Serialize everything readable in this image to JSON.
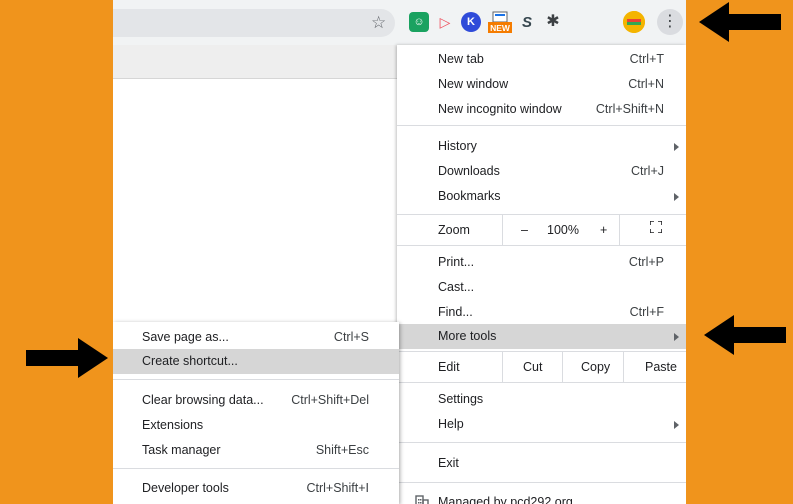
{
  "toolbar": {
    "extensions": [
      {
        "icon": "smiley-extension-icon",
        "glyph": "☺",
        "color": "#1aa260"
      },
      {
        "icon": "play-extension-icon",
        "glyph": "▷",
        "color": "#ee4c5a"
      },
      {
        "icon": "k-extension-icon",
        "glyph": "K",
        "color": "#2f4bd9"
      },
      {
        "icon": "new-badge-extension-icon",
        "badge": "NEW",
        "color": "#f57c00"
      },
      {
        "icon": "s-extension-icon",
        "glyph": "S",
        "color": "#37474f"
      },
      {
        "icon": "puzzle-extensions-icon",
        "glyph": "✱",
        "color": "#3c4043"
      },
      {
        "icon": "avatar-icon",
        "glyph": "",
        "color": "#f4b400"
      }
    ]
  },
  "menu": {
    "new_tab": {
      "label": "New tab",
      "shortcut": "Ctrl+T"
    },
    "new_window": {
      "label": "New window",
      "shortcut": "Ctrl+N"
    },
    "new_incognito": {
      "label": "New incognito window",
      "shortcut": "Ctrl+Shift+N"
    },
    "history": {
      "label": "History"
    },
    "downloads": {
      "label": "Downloads",
      "shortcut": "Ctrl+J"
    },
    "bookmarks": {
      "label": "Bookmarks"
    },
    "zoom": {
      "label": "Zoom",
      "minus": "–",
      "value": "100%",
      "plus": "+"
    },
    "print": {
      "label": "Print...",
      "shortcut": "Ctrl+P"
    },
    "cast": {
      "label": "Cast..."
    },
    "find": {
      "label": "Find...",
      "shortcut": "Ctrl+F"
    },
    "more_tools": {
      "label": "More tools"
    },
    "edit": {
      "label": "Edit",
      "cut": "Cut",
      "copy": "Copy",
      "paste": "Paste"
    },
    "settings": {
      "label": "Settings"
    },
    "help": {
      "label": "Help"
    },
    "exit": {
      "label": "Exit"
    },
    "managed": {
      "label": "Managed by pcd292.org"
    }
  },
  "submenu": {
    "save_page": {
      "label": "Save page as...",
      "shortcut": "Ctrl+S"
    },
    "create_shortcut": {
      "label": "Create shortcut..."
    },
    "clear_browsing": {
      "label": "Clear browsing data...",
      "shortcut": "Ctrl+Shift+Del"
    },
    "extensions": {
      "label": "Extensions"
    },
    "task_manager": {
      "label": "Task manager",
      "shortcut": "Shift+Esc"
    },
    "developer_tools": {
      "label": "Developer tools",
      "shortcut": "Ctrl+Shift+I"
    }
  },
  "colors": {
    "background": "#F0941C",
    "highlight": "#d6d6d6",
    "arrow": "#000000"
  }
}
